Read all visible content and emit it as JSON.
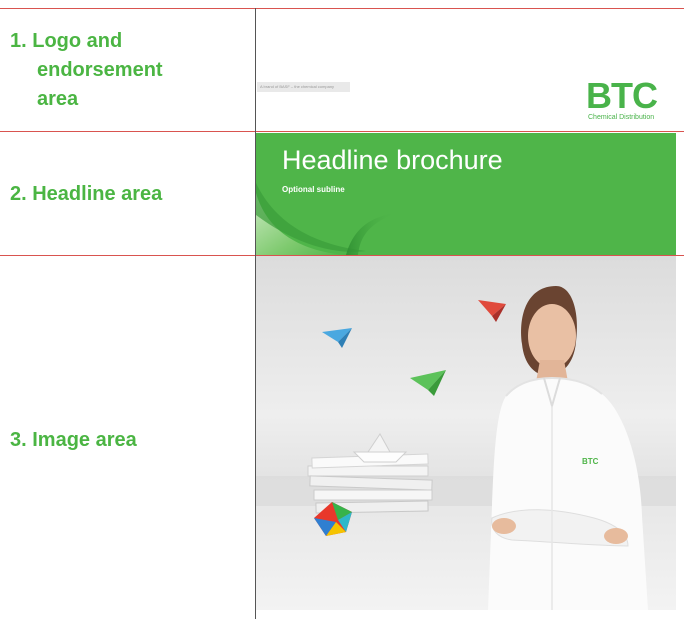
{
  "labels": {
    "logo_area_line1": "1. Logo and",
    "logo_area_line2": "endorsement",
    "logo_area_line3": "area",
    "headline_area": "2. Headline area",
    "image_area": "3. Image area"
  },
  "brochure": {
    "endorsement": "A brand of BASF – the chemical company",
    "logo_text": "BTC",
    "logo_sub": "Chemical Distribution",
    "headline": "Headline brochure",
    "subline": "Optional subline",
    "shirt_logo": "BTC"
  },
  "colors": {
    "brand_green": "#4fb549",
    "divider_red": "#d9534f"
  }
}
